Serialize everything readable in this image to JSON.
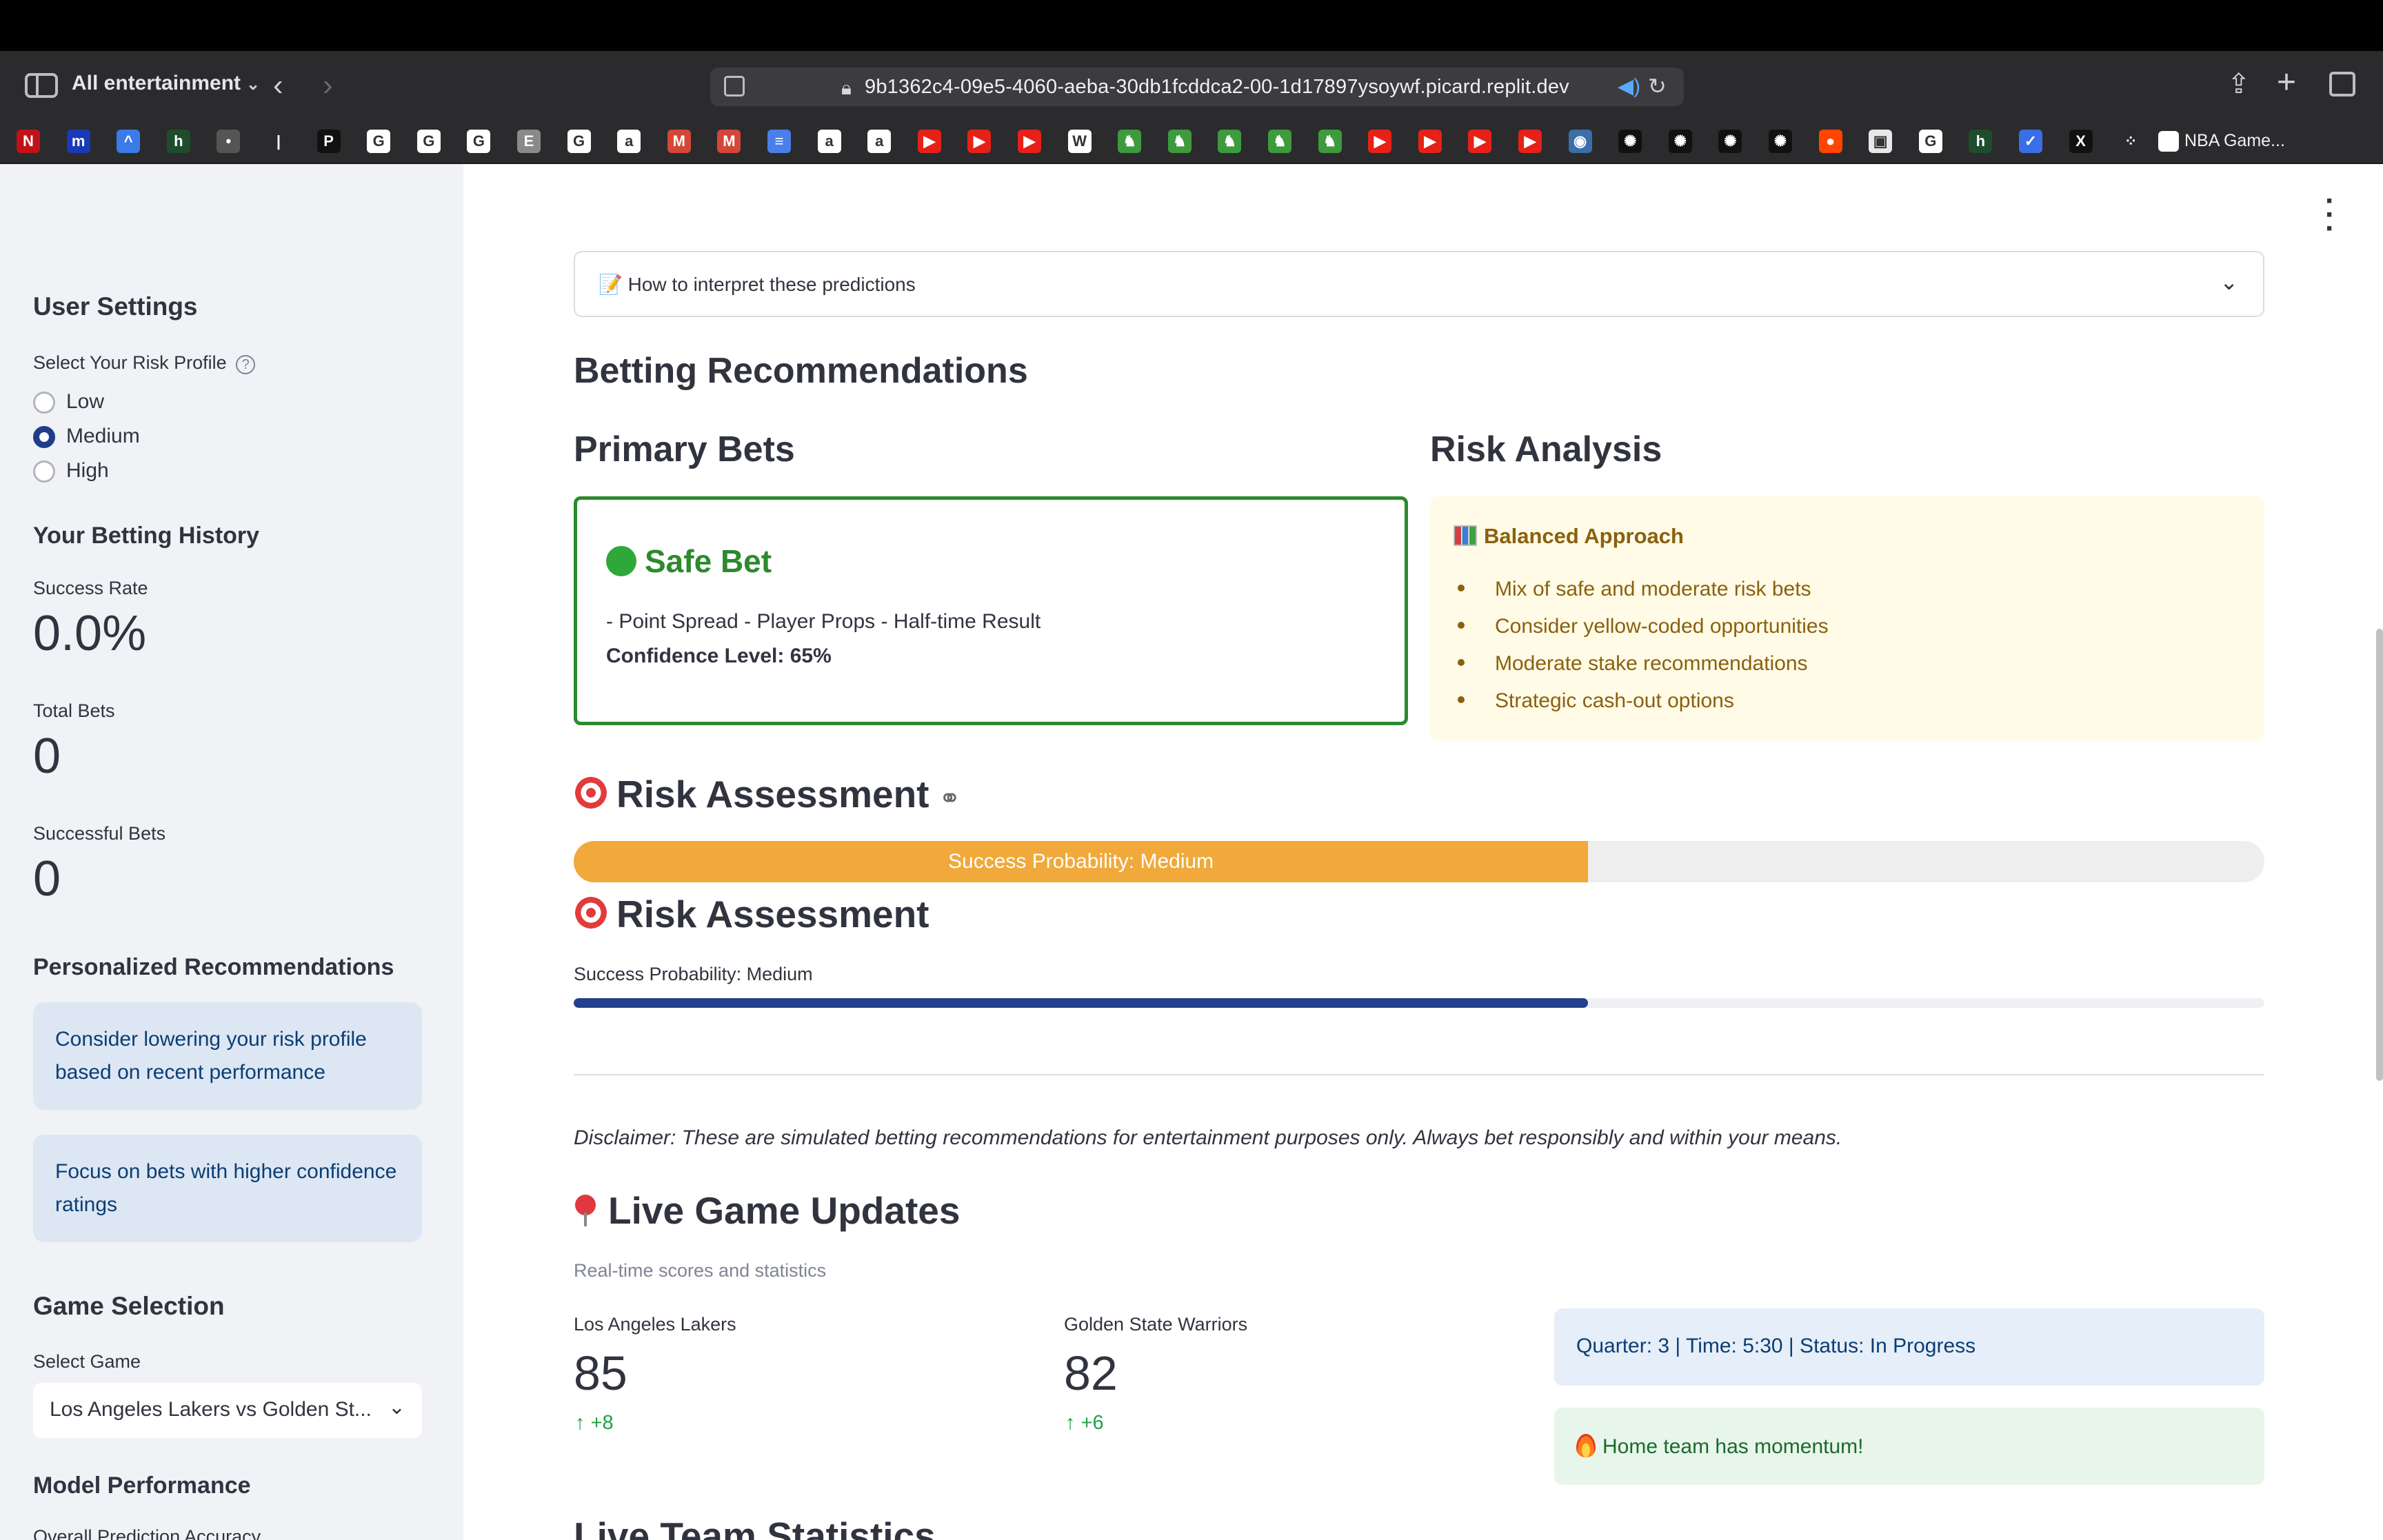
{
  "browser": {
    "tab_group": "All entertainment",
    "url": "9b1362c4-09e5-4060-aeba-30db1fcddca2-00-1d17897ysoywf.picard.replit.dev",
    "nba_tab_label": "NBA Game..."
  },
  "bookmarks": [
    {
      "icon": "netflix-icon",
      "letter": "N",
      "color": "#c11119"
    },
    {
      "icon": "m-icon",
      "letter": "m",
      "color": "#1a39b8"
    },
    {
      "icon": "arc-icon",
      "letter": "^",
      "color": "#3a7be8"
    },
    {
      "icon": "h-icon",
      "letter": "h",
      "color": "#1e4d2b"
    },
    {
      "icon": "nbc-icon",
      "letter": "•",
      "color": "#555555"
    },
    {
      "icon": "nba-icon",
      "letter": "|",
      "color": "#2b2b2d"
    },
    {
      "icon": "p-icon",
      "letter": "P",
      "color": "#111111"
    },
    {
      "icon": "google-icon",
      "letter": "G",
      "color": "#ffffff"
    },
    {
      "icon": "google-icon",
      "letter": "G",
      "color": "#ffffff"
    },
    {
      "icon": "google-icon",
      "letter": "G",
      "color": "#ffffff"
    },
    {
      "icon": "e-icon",
      "letter": "E",
      "color": "#8a8a8a"
    },
    {
      "icon": "google-icon",
      "letter": "G",
      "color": "#ffffff"
    },
    {
      "icon": "amazon-icon",
      "letter": "a",
      "color": "#ffffff"
    },
    {
      "icon": "gmail-icon",
      "letter": "M",
      "color": "#d44638"
    },
    {
      "icon": "gmail-icon",
      "letter": "M",
      "color": "#d44638"
    },
    {
      "icon": "docs-icon",
      "letter": "≡",
      "color": "#4a7ee8"
    },
    {
      "icon": "amazon-icon",
      "letter": "a",
      "color": "#ffffff"
    },
    {
      "icon": "amazon-icon",
      "letter": "a",
      "color": "#ffffff"
    },
    {
      "icon": "youtube-icon",
      "letter": "▶",
      "color": "#e62117"
    },
    {
      "icon": "youtube-icon",
      "letter": "▶",
      "color": "#e62117"
    },
    {
      "icon": "youtube-icon",
      "letter": "▶",
      "color": "#e62117"
    },
    {
      "icon": "wikipedia-icon",
      "letter": "W",
      "color": "#ffffff"
    },
    {
      "icon": "green-icon",
      "letter": "♞",
      "color": "#3d9a3d"
    },
    {
      "icon": "green-icon",
      "letter": "♞",
      "color": "#3d9a3d"
    },
    {
      "icon": "green-icon",
      "letter": "♞",
      "color": "#3d9a3d"
    },
    {
      "icon": "green-icon",
      "letter": "♞",
      "color": "#3d9a3d"
    },
    {
      "icon": "green-icon",
      "letter": "♞",
      "color": "#3d9a3d"
    },
    {
      "icon": "youtube-icon",
      "letter": "▶",
      "color": "#e62117"
    },
    {
      "icon": "youtube-icon",
      "letter": "▶",
      "color": "#e62117"
    },
    {
      "icon": "youtube-icon",
      "letter": "▶",
      "color": "#e62117"
    },
    {
      "icon": "youtube-icon",
      "letter": "▶",
      "color": "#e62117"
    },
    {
      "icon": "globe-icon",
      "letter": "◉",
      "color": "#3c6ea8"
    },
    {
      "icon": "openai-icon",
      "letter": "✺",
      "color": "#111111"
    },
    {
      "icon": "openai-icon",
      "letter": "✺",
      "color": "#111111"
    },
    {
      "icon": "openai-icon",
      "letter": "✺",
      "color": "#111111"
    },
    {
      "icon": "openai-icon",
      "letter": "✺",
      "color": "#111111"
    },
    {
      "icon": "reddit-icon",
      "letter": "●",
      "color": "#ff4500"
    },
    {
      "icon": "box-icon",
      "letter": "▣",
      "color": "#e8e8ea"
    },
    {
      "icon": "google-icon",
      "letter": "G",
      "color": "#ffffff"
    },
    {
      "icon": "h-icon",
      "letter": "h",
      "color": "#1e4d2b"
    },
    {
      "icon": "chart-icon",
      "letter": "✓",
      "color": "#3a6ee8"
    },
    {
      "icon": "x-icon",
      "letter": "X",
      "color": "#111111"
    },
    {
      "icon": "dots-icon",
      "letter": "⁘",
      "color": "#2b2b2d"
    }
  ],
  "sidebar": {
    "user_settings": "User Settings",
    "risk_label": "Select Your Risk Profile",
    "risk_options": [
      "Low",
      "Medium",
      "High"
    ],
    "risk_selected": "Medium",
    "history_heading": "Your Betting History",
    "success_rate_label": "Success Rate",
    "success_rate_value": "0.0%",
    "total_bets_label": "Total Bets",
    "total_bets_value": "0",
    "successful_bets_label": "Successful Bets",
    "successful_bets_value": "0",
    "recommendations_heading": "Personalized Recommendations",
    "recommendations": [
      "Consider lowering your risk profile based on recent performance",
      "Focus on bets with higher confidence ratings"
    ],
    "game_selection_heading": "Game Selection",
    "select_game_label": "Select Game",
    "selected_game": "Los Angeles Lakers vs Golden St...",
    "model_performance_heading": "Model Performance",
    "overall_accuracy_label": "Overall Prediction Accuracy"
  },
  "main": {
    "expander_label": "📝 How to interpret these predictions",
    "betting_heading": "Betting Recommendations",
    "primary_bets_heading": "Primary Bets",
    "risk_analysis_heading": "Risk Analysis",
    "safe_bet": {
      "title": "Safe Bet",
      "types": "- Point Spread - Player Props - Half-time Result",
      "confidence": "Confidence Level: 65%",
      "color": "#2c8a2c"
    },
    "risk_analysis": {
      "title": "Balanced Approach",
      "items": [
        "Mix of safe and moderate risk bets",
        "Consider yellow-coded opportunities",
        "Moderate stake recommendations",
        "Strategic cash-out options"
      ],
      "color": "#8a6010"
    },
    "risk_assessment_heading": "Risk Assessment",
    "probability_text": "Success Probability: Medium",
    "probability_fraction": 0.6,
    "probability_color": "#f0a93a",
    "bar2_color": "#22408c",
    "disclaimer": "Disclaimer: These are simulated betting recommendations for entertainment purposes only. Always bet responsibly and within your means.",
    "live_heading": "Live Game Updates",
    "live_caption": "Real-time scores and statistics",
    "home_team": {
      "name": "Los Angeles Lakers",
      "score": "85",
      "delta": "+8"
    },
    "away_team": {
      "name": "Golden State Warriors",
      "score": "82",
      "delta": "+6"
    },
    "status": "Quarter: 3 | Time: 5:30 | Status: In Progress",
    "momentum": "Home team has momentum!",
    "team_stats_heading": "Live Team Statistics"
  }
}
